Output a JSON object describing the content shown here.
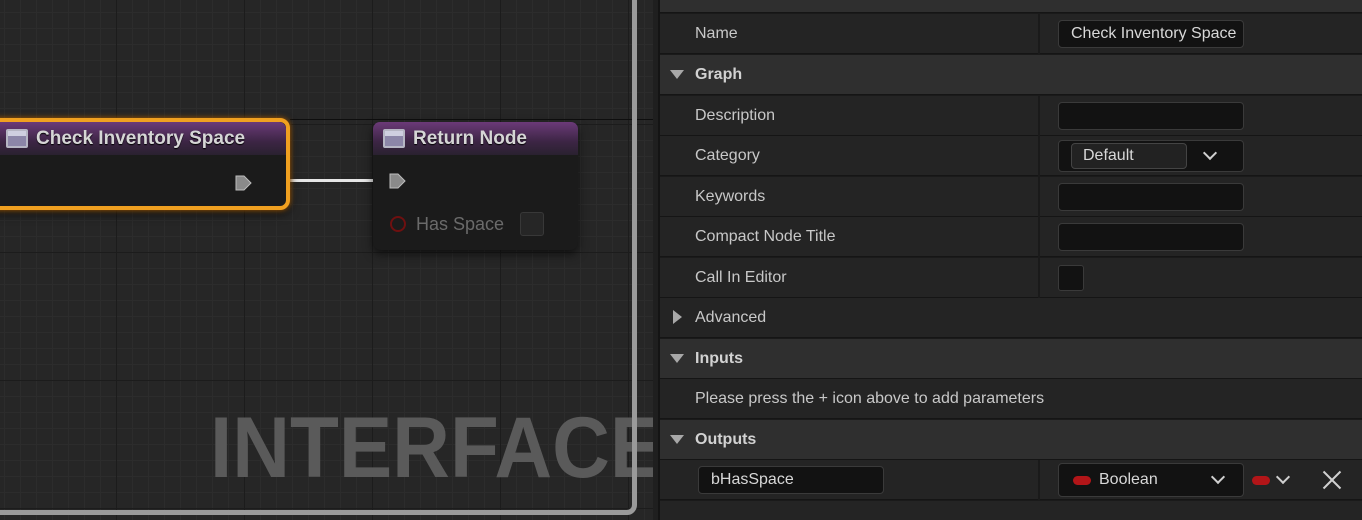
{
  "graph": {
    "watermark": "INTERFACE",
    "nodes": {
      "function_entry": {
        "title": "Check Inventory Space"
      },
      "return_node": {
        "title": "Return Node",
        "pin_label": "Has Space"
      }
    }
  },
  "details": {
    "name_row": {
      "label": "Name",
      "value": "Check Inventory Space"
    },
    "graph_section": {
      "title": "Graph",
      "description": {
        "label": "Description",
        "value": ""
      },
      "category": {
        "label": "Category",
        "value": "Default"
      },
      "keywords": {
        "label": "Keywords",
        "value": ""
      },
      "compact_node_title": {
        "label": "Compact Node Title",
        "value": ""
      },
      "call_in_editor": {
        "label": "Call In Editor",
        "checked": false
      },
      "advanced": {
        "label": "Advanced"
      }
    },
    "inputs_section": {
      "title": "Inputs",
      "hint": "Please press the + icon above to add parameters"
    },
    "outputs_section": {
      "title": "Outputs",
      "parameter": {
        "name": "bHasSpace",
        "type": "Boolean",
        "type_color": "#b21518"
      }
    }
  },
  "colors": {
    "selection_outline": "#f0a020",
    "function_header": "#6b3a78",
    "boolean_pin": "#b21518"
  }
}
